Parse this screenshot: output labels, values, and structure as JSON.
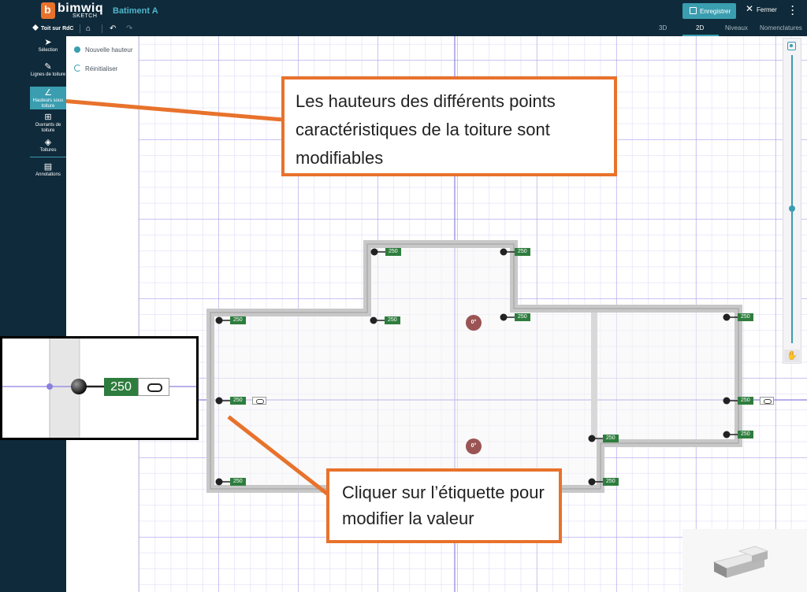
{
  "app": {
    "brand": "bimwiq",
    "brand_sub": "SKETCH",
    "project_name": "Batiment A",
    "save_label": "Enregistrer",
    "close_label": "Fermer",
    "more_icon": "more-vertical-icon"
  },
  "subbar": {
    "roof_selector": "Toit sur RdC",
    "tabs": [
      "3D",
      "2D",
      "Niveaux",
      "Nomenclatures"
    ],
    "active_tab": "2D"
  },
  "sidebar": {
    "items": [
      {
        "label": "Sélection",
        "icon": "cursor-icon"
      },
      {
        "label": "Lignes de toiture",
        "icon": "pen-icon"
      },
      {
        "label": "Hauteurs sous toiture",
        "icon": "angle-icon",
        "active": true
      },
      {
        "label": "Ouvrants de toiture",
        "icon": "window-icon"
      },
      {
        "label": "Toitures",
        "icon": "layers-icon"
      },
      {
        "label": "Annotations",
        "icon": "comment-icon"
      }
    ]
  },
  "panel": {
    "new_height": "Nouvelle hauteur",
    "reset": "Réinitialiser"
  },
  "canvas": {
    "height_labels": [
      "250",
      "250",
      "250",
      "250",
      "250",
      "250",
      "250",
      "250",
      "250",
      "250",
      "250",
      "250",
      "250",
      "250"
    ],
    "angle_labels": [
      "0°",
      "0°"
    ]
  },
  "inset": {
    "value": "250"
  },
  "callouts": {
    "top": "Les hauteurs des différents points caractéristiques de la toiture sont modifiables",
    "bottom": "Cliquer sur l’étiquette pour modifier la valeur"
  },
  "colors": {
    "dark": "#0f2a3a",
    "accent": "#3a9db0",
    "callout": "#e8722c",
    "label_green": "#2e7d3e"
  }
}
